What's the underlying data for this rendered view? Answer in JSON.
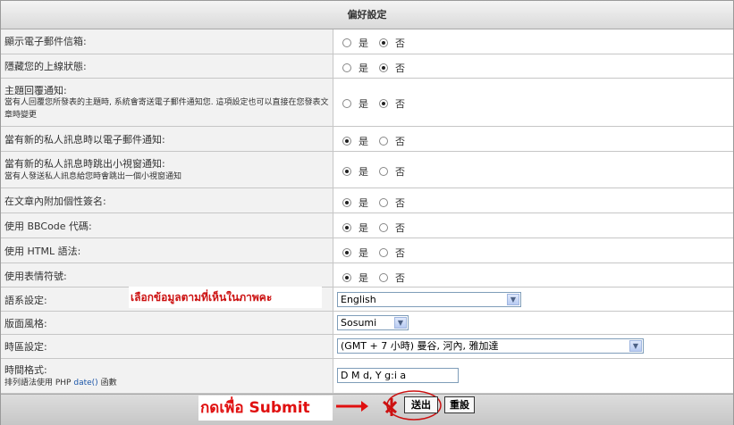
{
  "header": {
    "title": "偏好設定"
  },
  "radio_labels": {
    "yes": "是",
    "no": "否"
  },
  "rows": [
    {
      "label": "顯示電子郵件信箱:",
      "selected": "no"
    },
    {
      "label": "隱藏您的上線狀態:",
      "selected": "no"
    },
    {
      "label": "主題回覆通知:",
      "desc": "當有人回覆您所發表的主題時, 系統會寄送電子郵件通知您. 這項設定也可以直接在您發表文章時變更",
      "selected": "no"
    },
    {
      "label": "當有新的私人訊息時以電子郵件通知:",
      "selected": "yes"
    },
    {
      "label": "當有新的私人訊息時跳出小視窗通知:",
      "desc": "當有人發送私人訊息給您時會跳出一個小視窗通知",
      "selected": "yes"
    },
    {
      "label": "在文章內附加個性簽名:",
      "selected": "yes"
    },
    {
      "label": "使用 BBCode 代碼:",
      "selected": "yes"
    },
    {
      "label": "使用 HTML 語法:",
      "selected": "yes"
    },
    {
      "label": "使用表情符號:",
      "selected": "yes"
    }
  ],
  "language": {
    "label": "語系設定:",
    "value": "English"
  },
  "annotation": "เลือกข้อมูลตามที่เห็นในภาพคะ",
  "style": {
    "label": "版面風格:",
    "value": "Sosumi"
  },
  "timezone": {
    "label": "時區設定:",
    "value": "(GMT + 7 小時) 曼谷, 河內, 雅加達"
  },
  "dateformat": {
    "label": "時間格式:",
    "desc_prefix": "排列語法使用 PHP",
    "desc_link": "date()",
    "desc_suffix": "函數",
    "value": "D M d, Y g:i a"
  },
  "footer": {
    "submit_annotation": "กดเพื่อ Submit",
    "submit": "送出",
    "reset": "重設"
  },
  "colors": {
    "annotation": "#e01010",
    "marker": "#cc1111",
    "arrow": "#e01010",
    "circle": "#cc1111",
    "link": "#1a55a8"
  }
}
